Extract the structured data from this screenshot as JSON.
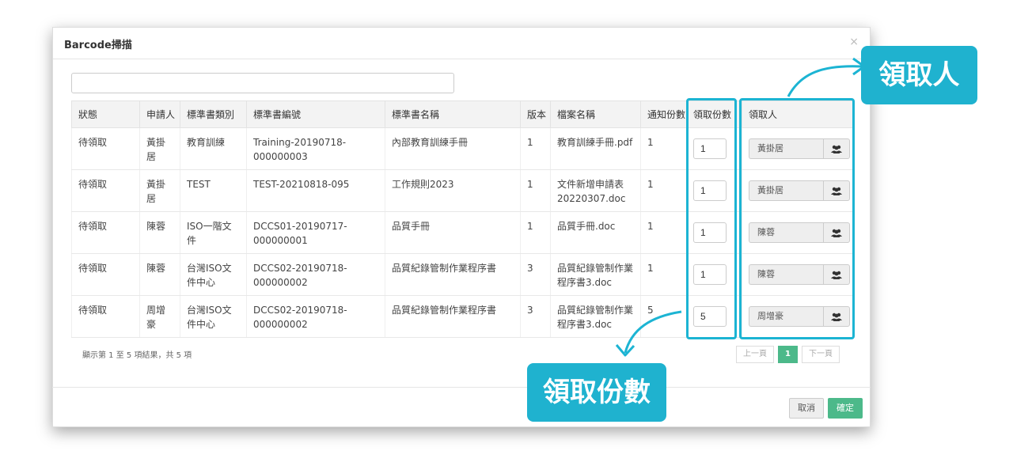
{
  "modal": {
    "title": "Barcode掃描",
    "close_glyph": "×",
    "search_value": ""
  },
  "table": {
    "headers": [
      "狀態",
      "申請人",
      "標準書類別",
      "標準書編號",
      "標準書名稱",
      "版本",
      "檔案名稱",
      "通知份數",
      "領取份數",
      "領取人"
    ],
    "rows": [
      {
        "status": "待領取",
        "applicant": "黃掛居",
        "category": "教育訓練",
        "number": "Training-20190718-000000003",
        "name": "內部教育訓練手冊",
        "version": "1",
        "file": "教育訓練手冊.pdf",
        "notify": "1",
        "qty": "1",
        "receiver": "黃掛居"
      },
      {
        "status": "待領取",
        "applicant": "黃掛居",
        "category": "TEST",
        "number": "TEST-20210818-095",
        "name": "工作規則2023",
        "version": "1",
        "file": "文件新增申請表20220307.doc",
        "notify": "1",
        "qty": "1",
        "receiver": "黃掛居"
      },
      {
        "status": "待領取",
        "applicant": "陳蓉",
        "category": "ISO一階文件",
        "number": "DCCS01-20190717-000000001",
        "name": "品質手冊",
        "version": "1",
        "file": "品質手冊.doc",
        "notify": "1",
        "qty": "1",
        "receiver": "陳蓉"
      },
      {
        "status": "待領取",
        "applicant": "陳蓉",
        "category": "台灣ISO文件中心",
        "number": "DCCS02-20190718-000000002",
        "name": "品質紀錄管制作業程序書",
        "version": "3",
        "file": "品質紀錄管制作業程序書3.doc",
        "notify": "1",
        "qty": "1",
        "receiver": "陳蓉"
      },
      {
        "status": "待領取",
        "applicant": "周增豪",
        "category": "台灣ISO文件中心",
        "number": "DCCS02-20190718-000000002",
        "name": "品質紀錄管制作業程序書",
        "version": "3",
        "file": "品質紀錄管制作業程序書3.doc",
        "notify": "5",
        "qty": "5",
        "receiver": "周增豪"
      }
    ]
  },
  "info_text": "顯示第 1 至 5 項結果，共 5 項",
  "pager": {
    "prev": "上一頁",
    "current": "1",
    "next": "下一頁"
  },
  "buttons": {
    "cancel": "取消",
    "ok": "確定"
  },
  "callouts": {
    "receiver": "領取人",
    "quantity": "領取份數"
  },
  "colors": {
    "accent": "#1fb2cf",
    "primary_green": "#4cb98a"
  },
  "icons": {
    "receiver_button": "users-icon"
  }
}
